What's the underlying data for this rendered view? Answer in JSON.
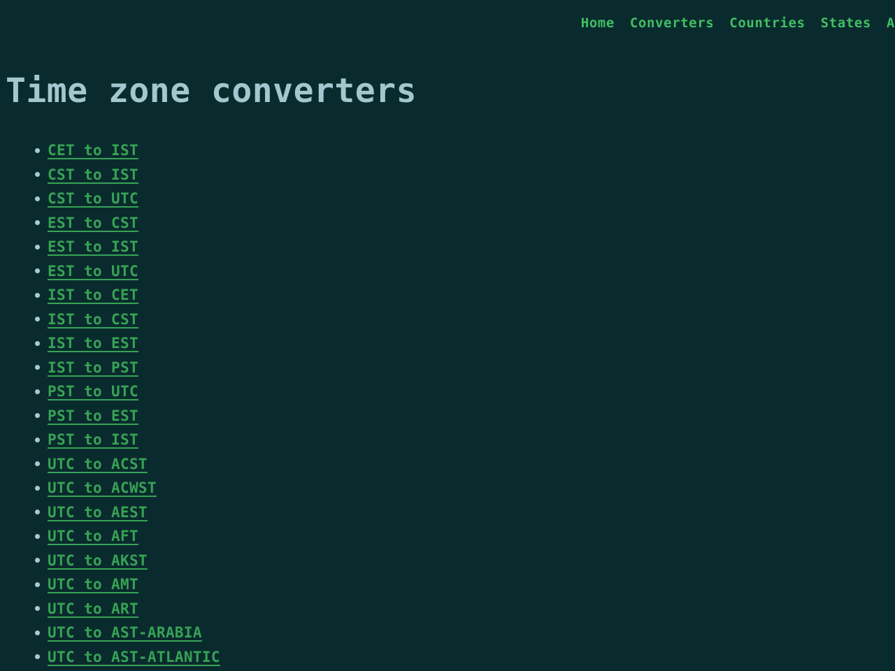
{
  "nav": {
    "items": [
      {
        "label": "Home",
        "name": "nav-link-home"
      },
      {
        "label": "Converters",
        "name": "nav-link-converters"
      },
      {
        "label": "Countries",
        "name": "nav-link-countries"
      },
      {
        "label": "States",
        "name": "nav-link-states"
      },
      {
        "label": "AWS",
        "name": "nav-link-aws"
      }
    ]
  },
  "main": {
    "title": "Time zone converters",
    "converters": [
      {
        "label": "CET to IST"
      },
      {
        "label": "CST to IST"
      },
      {
        "label": "CST to UTC"
      },
      {
        "label": "EST to CST"
      },
      {
        "label": "EST to IST"
      },
      {
        "label": "EST to UTC"
      },
      {
        "label": "IST to CET"
      },
      {
        "label": "IST to CST"
      },
      {
        "label": "IST to EST"
      },
      {
        "label": "IST to PST"
      },
      {
        "label": "PST to UTC"
      },
      {
        "label": "PST to EST"
      },
      {
        "label": "PST to IST"
      },
      {
        "label": "UTC to ACST"
      },
      {
        "label": "UTC to ACWST"
      },
      {
        "label": "UTC to AEST"
      },
      {
        "label": "UTC to AFT"
      },
      {
        "label": "UTC to AKST"
      },
      {
        "label": "UTC to AMT"
      },
      {
        "label": "UTC to ART"
      },
      {
        "label": "UTC to AST-ARABIA"
      },
      {
        "label": "UTC to AST-ATLANTIC"
      }
    ]
  },
  "colors": {
    "background": "#0a2b2e",
    "nav_link": "#41bf63",
    "body_link": "#37a355",
    "heading": "#a2c7ce",
    "bullet": "#a7cbd2"
  }
}
